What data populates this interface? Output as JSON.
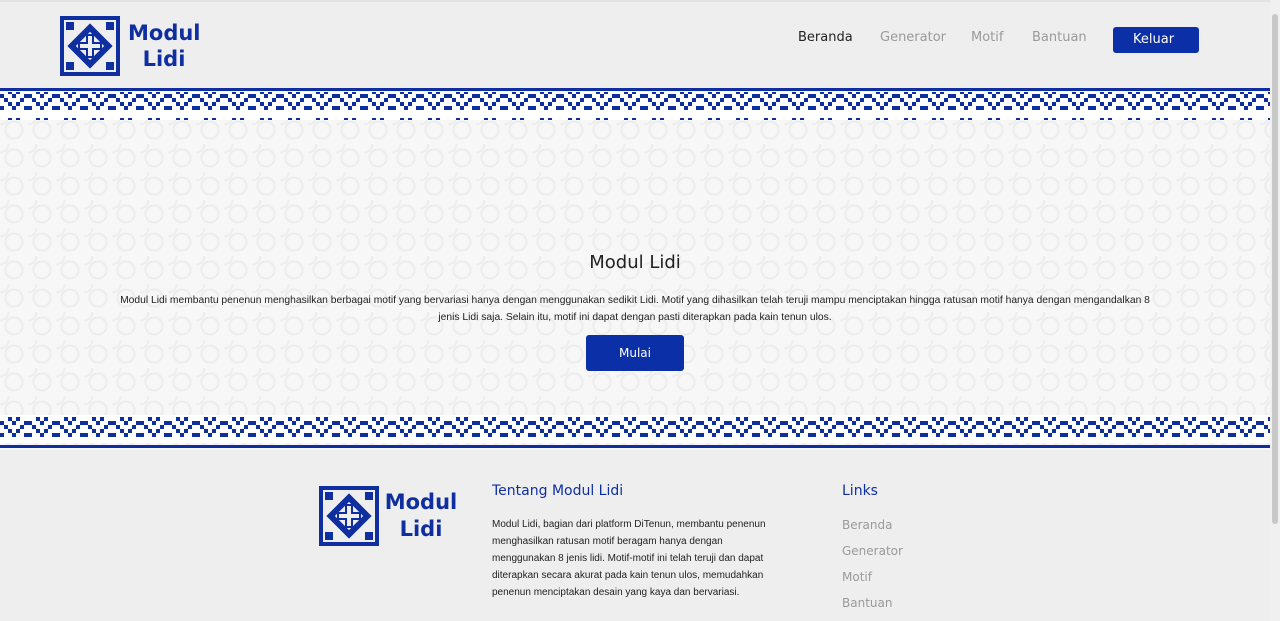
{
  "header": {
    "logo_text": "Modul Lidi",
    "nav": [
      "Beranda",
      "Generator",
      "Motif",
      "Bantuan"
    ],
    "active_nav": "Beranda",
    "logout_label": "Keluar"
  },
  "hero": {
    "title": "Modul Lidi",
    "description": "Modul Lidi membantu penenun menghasilkan berbagai motif yang bervariasi hanya dengan menggunakan sedikit Lidi. Motif yang dihasilkan telah teruji mampu menciptakan hingga ratusan motif hanya dengan mengandalkan 8 jenis Lidi saja. Selain itu, motif ini dapat dengan pasti diterapkan pada kain tenun ulos.",
    "start_label": "Mulai"
  },
  "footer": {
    "logo_text": "Modul Lidi",
    "about_title": "Tentang Modul Lidi",
    "about_text": "Modul Lidi, bagian dari platform DiTenun, membantu penenun menghasilkan ratusan motif beragam hanya dengan menggunakan 8 jenis lidi. Motif-motif ini telah teruji dan dapat diterapkan secara akurat pada kain tenun ulos, memudahkan penenun menciptakan desain yang kaya dan bervariasi.",
    "links_title": "Links",
    "links": [
      "Beranda",
      "Generator",
      "Motif",
      "Bantuan"
    ]
  },
  "colors": {
    "primary": "#0b2fa6",
    "brand_text": "#0f2fa0",
    "background": "#eeeeee"
  },
  "icons": {
    "logo": "ulos-motif-logo-icon",
    "logout": "logout-arrow-icon"
  }
}
